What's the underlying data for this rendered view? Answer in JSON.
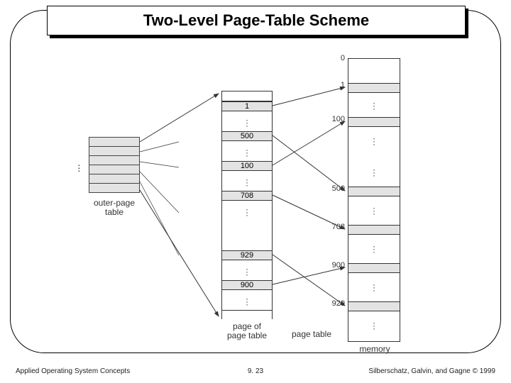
{
  "title": "Two-Level Page-Table Scheme",
  "outer_page_table": {
    "caption": "outer-page\ntable",
    "visible_rows": 6
  },
  "page_of_page_table": {
    "caption": "page of\npage table",
    "group_caption": "page table",
    "entries": [
      "1",
      "500",
      "100",
      "708",
      "929",
      "900"
    ]
  },
  "memory": {
    "caption": "memory",
    "top_label": "0",
    "address_labels": [
      "1",
      "100",
      "500",
      "708",
      "900",
      "929"
    ]
  },
  "footer": {
    "left": "Applied Operating System Concepts",
    "center": "9. 23",
    "right": "Silberschatz, Galvin, and Gagne © 1999"
  }
}
